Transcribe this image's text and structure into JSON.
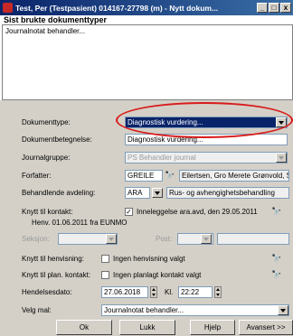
{
  "window": {
    "title": "Test, Per (Testpasient)  014167-27798 (m) - Nytt dokum...",
    "buttons": [
      "_",
      "□",
      "x"
    ]
  },
  "recent": {
    "title": "Sist brukte dokumenttyper",
    "items": [
      "Journalnotat behandler..."
    ]
  },
  "form": {
    "dokumenttype_label": "Dokumenttype:",
    "dokumenttype_value": "Diagnostisk vurdering...",
    "betegnelse_label": "Dokumentbetegnelse:",
    "betegnelse_value": "Diagnostisk vurdering...",
    "journalgruppe_label": "Journalgruppe:",
    "journalgruppe_value": "PS Behandler journal",
    "forfatter_label": "Forfatter:",
    "forfatter_code": "GREILE",
    "forfatter_name": "Eilertsen, Gro Merete Grønvold, Søland",
    "avdeling_label": "Behandlende avdeling:",
    "avdeling_code": "ARA",
    "avdeling_name": "Rus- og avhengighetsbehandling",
    "kontakt_label": "Knytt til kontakt:",
    "kontakt_check": "✓",
    "kontakt_value": "Inneleggelse ara.avd, den 29.05.2011",
    "kontakt_sub": "Henv. 01.06.2011 fra EUNMO",
    "seksjon_label": "Seksjon:",
    "post_label": "Post:",
    "henvisning_label": "Knytt til henvisning:",
    "henvisning_value": "Ingen henvisning valgt",
    "plankontakt_label": "Knytt til plan. kontakt:",
    "plankontakt_value": "Ingen planlagt kontakt valgt",
    "hendelse_label": "Hendelsesdato:",
    "hendelse_date": "27.06.2018",
    "kl_label": "Kl.",
    "hendelse_time": "22:22",
    "mal_label": "Velg mal:",
    "mal_value": "Journalnotat behandler..."
  },
  "buttons": {
    "ok": "Ok",
    "lukk": "Lukk",
    "hjelp": "Hjelp",
    "avansert": "Avansert >>"
  },
  "icons": {
    "binoculars": "🔭"
  }
}
